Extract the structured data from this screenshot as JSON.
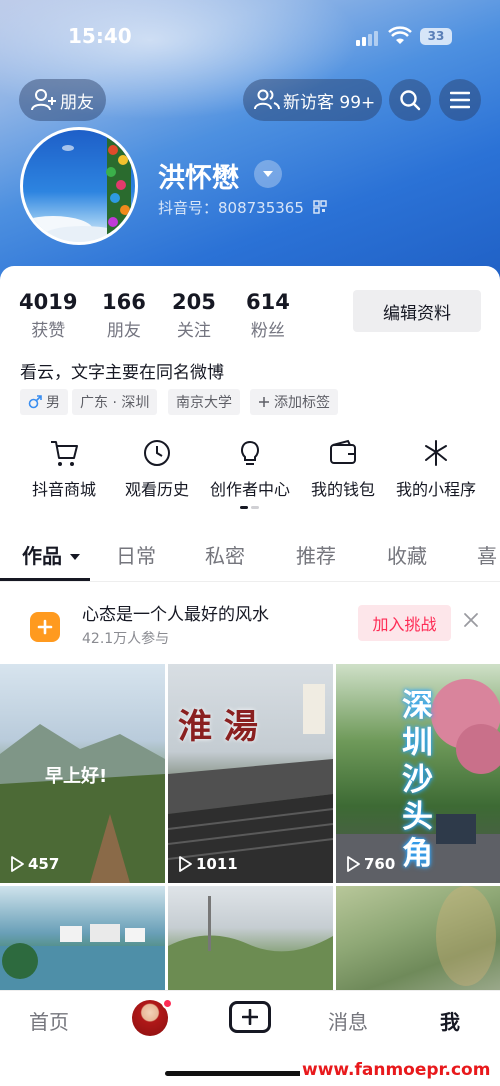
{
  "status_bar": {
    "time": "15:40",
    "battery": "33"
  },
  "header": {
    "friends_label": "朋友",
    "visitors_label": "新访客 99+",
    "name": "洪怀懋",
    "douyin_id": "抖音号：808735365"
  },
  "stats": [
    {
      "value": "4019",
      "label": "获赞"
    },
    {
      "value": "166",
      "label": "朋友"
    },
    {
      "value": "205",
      "label": "关注"
    },
    {
      "value": "614",
      "label": "粉丝"
    }
  ],
  "edit_profile_label": "编辑资料",
  "bio": "看云，文字主要在同名微博",
  "tags": {
    "gender": "男",
    "location": "广东 · 深圳",
    "school": "南京大学",
    "add": "添加标签"
  },
  "tools": [
    {
      "label": "抖音商城",
      "icon": "cart-icon"
    },
    {
      "label": "观看历史",
      "icon": "clock-icon"
    },
    {
      "label": "创作者中心",
      "icon": "lightbulb-icon"
    },
    {
      "label": "我的钱包",
      "icon": "wallet-icon"
    },
    {
      "label": "我的小程序",
      "icon": "asterisk-icon"
    }
  ],
  "tabs": [
    "作品",
    "日常",
    "私密",
    "推荐",
    "收藏",
    "喜"
  ],
  "challenge": {
    "title": "心态是一个人最好的风水",
    "participants": "42.1万人参与",
    "join_label": "加入挑战"
  },
  "videos": [
    {
      "overlay": "早上好!",
      "views": "457"
    },
    {
      "overlay": "淮 湯",
      "views": "1011"
    },
    {
      "overlay": "深圳沙头角",
      "views": "760"
    }
  ],
  "bottom_nav": {
    "home": "首页",
    "messages": "消息",
    "me": "我"
  },
  "watermark": "www.fanmoepr.com",
  "colors": {
    "accent": "#fe2c55",
    "header_blue": "#2b72d6",
    "challenge_orange": "#ff9a1f"
  }
}
